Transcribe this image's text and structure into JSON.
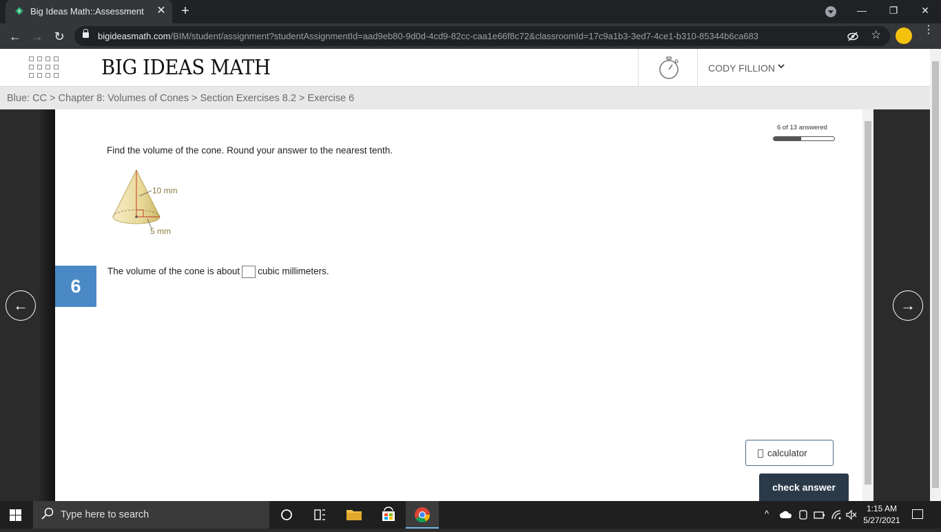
{
  "browser": {
    "tab_title": "Big Ideas Math::Assessment",
    "tab_close": "✕",
    "new_tab": "+",
    "url_host": "bigideasmath.com",
    "url_path": "/BIM/student/assignment?studentAssignmentId=aad9eb80-9d0d-4cd9-82cc-caa1e66f8c72&classroomId=17c9a1b3-3ed7-4ce1-b310-85344b6ca683",
    "back": "←",
    "forward": "→",
    "reload": "↻",
    "star": "☆",
    "menu": "⋮",
    "minimize": "—",
    "restore": "❐",
    "close": "✕"
  },
  "header": {
    "logo": "BIG IDEAS MATH",
    "user_name": "CODY FILLION",
    "user_chevron": "❯"
  },
  "breadcrumb": "Blue: CC > Chapter 8: Volumes of Cones > Section Exercises 8.2 > Exercise 6",
  "assessment": {
    "progress_label": "6 of 13 answered",
    "progress_fraction": 0.46,
    "question": "Find the volume of the cone. Round your answer to the nearest tenth.",
    "figure": {
      "height_label": "10 mm",
      "radius_label": "5 mm"
    },
    "number": "6",
    "answer_prefix": "The volume of the cone is about",
    "answer_suffix": "cubic millimeters.",
    "answer_value": "",
    "prev_arrow": "←",
    "next_arrow": "→",
    "calculator_label": "calculator",
    "check_label": "check answer"
  },
  "taskbar": {
    "search_placeholder": "Type here to search",
    "time": "1:15 AM",
    "date": "5/27/2021",
    "tray_expand": "^"
  },
  "colors": {
    "accent_blue": "#4a89c5",
    "check_button": "#2a3a49",
    "browser_dark": "#202124"
  }
}
